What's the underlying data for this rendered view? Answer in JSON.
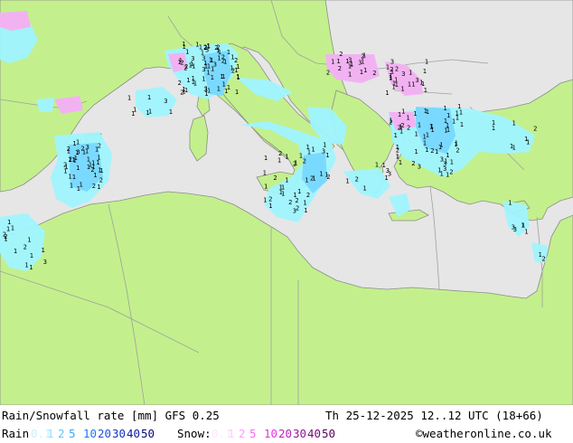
{
  "map": {
    "colors": {
      "sea": "#e6e6e6",
      "land": "#c3f08c",
      "border": "#a0a0a0",
      "coast": "#8c8c8c",
      "rain_light": "#a0f5ff",
      "rain_mid": "#7ad9ff",
      "snow_light": "#f2b2f2",
      "marker": "#000000"
    }
  },
  "footer": {
    "title": "Rain/Snowfall rate [mm] GFS 0.25",
    "datetime": "Th 25-12-2025 12..12 UTC (18+66)",
    "rain_label": "Rain",
    "snow_label": "Snow:",
    "credit": "©weatheronline.co.uk",
    "rain_levels": [
      {
        "text": "0.1",
        "color": "#c8f0ff"
      },
      {
        "text": "1",
        "color": "#96dcff"
      },
      {
        "text": "2",
        "color": "#5ac8ff"
      },
      {
        "text": "5",
        "color": "#32aaff"
      },
      {
        "text": "10",
        "color": "#1e78ff"
      },
      {
        "text": "20",
        "color": "#1e50e6"
      },
      {
        "text": "30",
        "color": "#1432c8"
      },
      {
        "text": "40",
        "color": "#0a1ea0"
      },
      {
        "text": "50",
        "color": "#000a78"
      }
    ],
    "snow_levels": [
      {
        "text": "0.1",
        "color": "#ffe6ff"
      },
      {
        "text": "1",
        "color": "#ffc8ff"
      },
      {
        "text": "2",
        "color": "#ff9bff"
      },
      {
        "text": "5",
        "color": "#ff64ff"
      },
      {
        "text": "10",
        "color": "#e632e6"
      },
      {
        "text": "20",
        "color": "#be1ebe"
      },
      {
        "text": "30",
        "color": "#961496"
      },
      {
        "text": "40",
        "color": "#780a78"
      },
      {
        "text": "50",
        "color": "#5a005a"
      }
    ]
  }
}
